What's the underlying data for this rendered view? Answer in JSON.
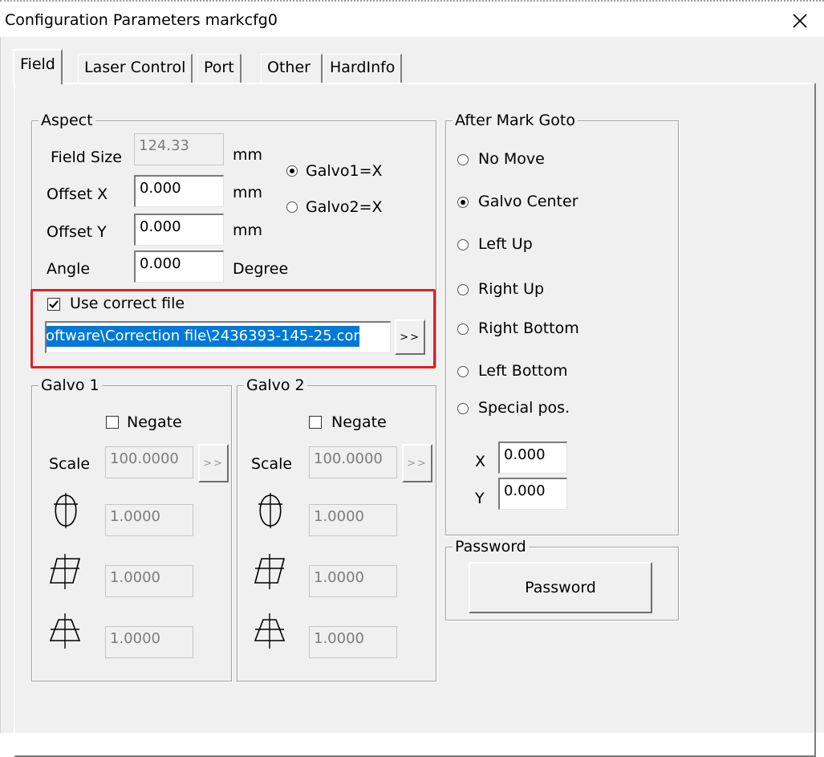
{
  "window": {
    "title": "Configuration Parameters markcfg0"
  },
  "tabs": [
    {
      "label": "Field",
      "active": true
    },
    {
      "label": "Laser Control",
      "active": false
    },
    {
      "label": "Port",
      "active": false
    },
    {
      "label": "Other",
      "active": false
    },
    {
      "label": "HardInfo",
      "active": false
    }
  ],
  "aspect": {
    "title": "Aspect",
    "field_size_label": "Field Size",
    "field_size_value": "124.33",
    "offset_x_label": "Offset X",
    "offset_x_value": "0.000",
    "offset_y_label": "Offset Y",
    "offset_y_value": "0.000",
    "angle_label": "Angle",
    "angle_value": "0.000",
    "unit_mm": "mm",
    "unit_degree": "Degree",
    "galvo1x_label": "Galvo1=X",
    "galvo1x_checked": true,
    "galvo2x_label": "Galvo2=X",
    "galvo2x_checked": false,
    "use_correct_file_label": "Use correct file",
    "use_correct_file_checked": true,
    "correction_file_path": "oftware\\Correction file\\2436393-145-25.cor",
    "browse_label": ">>",
    "highlight_color": "#e02020",
    "selection_color": "#0078d7"
  },
  "galvo1": {
    "title": "Galvo 1",
    "negate_label": "Negate",
    "negate_checked": false,
    "scale_label": "Scale",
    "scale_value": "100.0000",
    "scale_button": ">>",
    "param1_value": "1.0000",
    "param2_value": "1.0000",
    "param3_value": "1.0000"
  },
  "galvo2": {
    "title": "Galvo 2",
    "negate_label": "Negate",
    "negate_checked": false,
    "scale_label": "Scale",
    "scale_value": "100.0000",
    "scale_button": ">>",
    "param1_value": "1.0000",
    "param2_value": "1.0000",
    "param3_value": "1.0000"
  },
  "after_mark": {
    "title": "After Mark Goto",
    "options": [
      {
        "label": "No Move",
        "checked": false
      },
      {
        "label": "Galvo Center",
        "checked": true
      },
      {
        "label": "Left Up",
        "checked": false
      },
      {
        "label": "Right Up",
        "checked": false
      },
      {
        "label": "Right Bottom",
        "checked": false
      },
      {
        "label": "Left Bottom",
        "checked": false
      },
      {
        "label": "Special pos.",
        "checked": false
      }
    ],
    "x_label": "X",
    "x_value": "0.000",
    "y_label": "Y",
    "y_value": "0.000"
  },
  "password": {
    "title": "Password",
    "button_label": "Password"
  }
}
